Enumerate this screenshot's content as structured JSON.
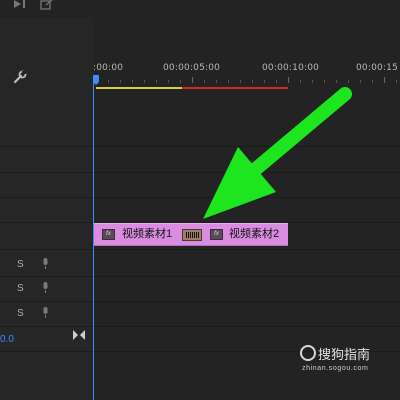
{
  "ruler": {
    "labels": [
      ":00:00",
      "00:00:05:00",
      "00:00:10:00",
      "00:00:15"
    ]
  },
  "clips": [
    {
      "fx": "fx",
      "name": "视频素材1"
    },
    {
      "fx": "fx",
      "name": "视频素材2"
    }
  ],
  "audio_tracks": [
    {
      "solo": "S"
    },
    {
      "solo": "S"
    },
    {
      "solo": "S"
    }
  ],
  "timecode": "0.0",
  "watermark": {
    "name": "搜狗指南",
    "url": "zhinan.sogou.com"
  },
  "colors": {
    "playhead": "#3f8bff",
    "clip": "#d98ce0",
    "work_area_yellow": "#d8cf3a",
    "work_area_red": "#cc2b22",
    "annotation_arrow": "#1ee61e"
  },
  "icons": [
    "export-frame-icon",
    "share-icon",
    "wrench-icon",
    "microphone-icon",
    "snap-icon"
  ]
}
